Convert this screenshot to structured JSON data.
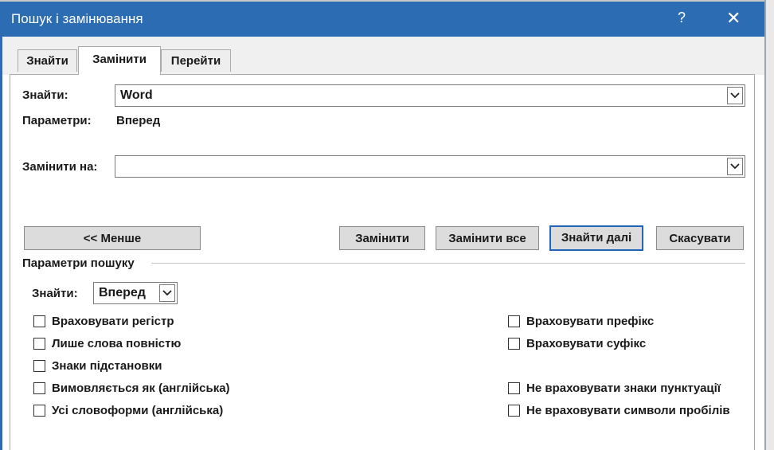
{
  "window": {
    "title": "Пошук і замінювання",
    "help_label": "?",
    "close_label": "✕"
  },
  "tabs": [
    {
      "label": "Знайти"
    },
    {
      "label": "Замінити"
    },
    {
      "label": "Перейти"
    }
  ],
  "find": {
    "label": "Знайти:",
    "value": "Word",
    "params_label": "Параметри:",
    "params_value": "Вперед"
  },
  "replace": {
    "label": "Замінити на:",
    "value": ""
  },
  "buttons": {
    "less": "<< Менше",
    "replace": "Замінити",
    "replace_all": "Замінити все",
    "find_next": "Знайти далі",
    "cancel": "Скасувати"
  },
  "search_options": {
    "group_label": "Параметри пошуку",
    "direction_label": "Знайти:",
    "direction_value": "Вперед",
    "left_options": [
      {
        "label": "Враховувати регістр",
        "checked": false
      },
      {
        "label": "Лише слова повністю",
        "checked": false
      },
      {
        "label": "Знаки підстановки",
        "checked": false
      },
      {
        "label": "Вимовляється як (англійська)",
        "checked": false
      },
      {
        "label": "Усі словоформи (англійська)",
        "checked": false
      }
    ],
    "right_options": [
      {
        "label": "Враховувати префікс",
        "checked": false
      },
      {
        "label": "Враховувати суфікс",
        "checked": false
      },
      {
        "label": "Не враховувати знаки пунктуації",
        "checked": false
      },
      {
        "label": "Не враховувати символи пробілів",
        "checked": false
      }
    ]
  },
  "colors": {
    "titlebar": "#2b6cb2",
    "default_button_border": "#1f64b8"
  }
}
